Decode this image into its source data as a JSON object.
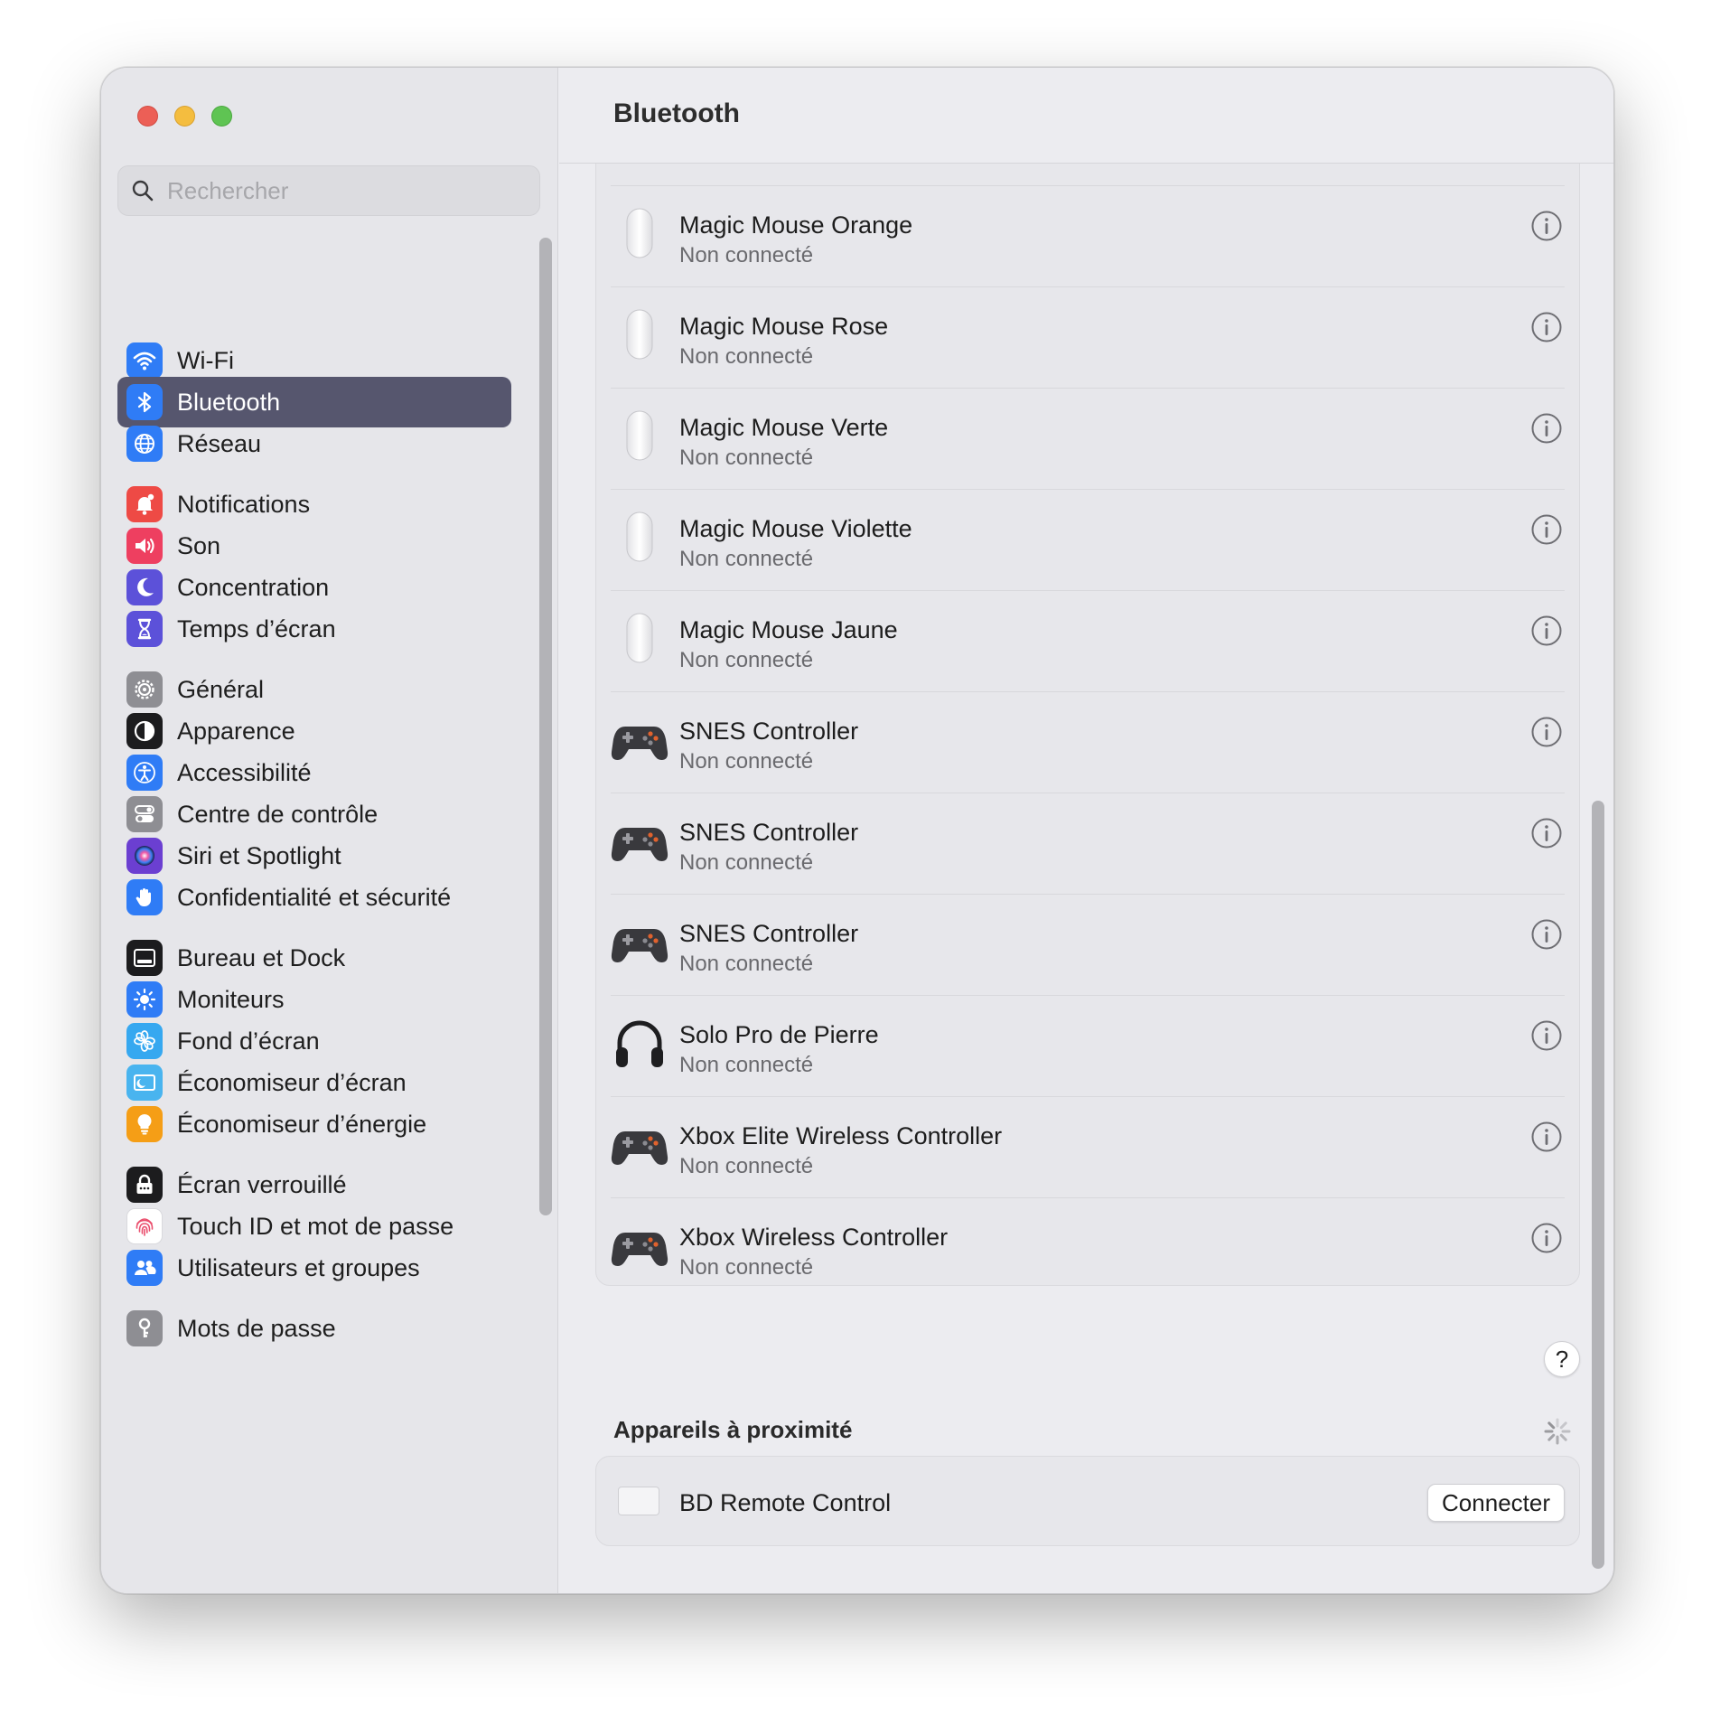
{
  "window": {
    "title": "Bluetooth"
  },
  "search": {
    "placeholder": "Rechercher"
  },
  "sidebar": {
    "items": [
      {
        "label": "Wi-Fi",
        "icon": "wifi-icon",
        "color": "#2f7cf6"
      },
      {
        "label": "Bluetooth",
        "icon": "bluetooth-icon",
        "color": "#2f7cf6",
        "active": true
      },
      {
        "label": "Réseau",
        "icon": "globe-icon",
        "color": "#2f7cf6"
      },
      {
        "label": "Notifications",
        "icon": "bell-icon",
        "color": "#ee4a45"
      },
      {
        "label": "Son",
        "icon": "speaker-icon",
        "color": "#ee3f60"
      },
      {
        "label": "Concentration",
        "icon": "moon-icon",
        "color": "#5c51d9"
      },
      {
        "label": "Temps d’écran",
        "icon": "hourglass-icon",
        "color": "#5c51d9"
      },
      {
        "label": "Général",
        "icon": "gear-icon",
        "color": "#8e8e93"
      },
      {
        "label": "Apparence",
        "icon": "appearance-icon",
        "color": "#1c1c1e"
      },
      {
        "label": "Accessibilité",
        "icon": "accessibility-icon",
        "color": "#2f7cf6"
      },
      {
        "label": "Centre de contrôle",
        "icon": "toggles-icon",
        "color": "#8e8e93"
      },
      {
        "label": "Siri et Spotlight",
        "icon": "siri-icon",
        "color": "#6b3fd1"
      },
      {
        "label": "Confidentialité et sécurité",
        "icon": "hand-icon",
        "color": "#2f7cf6"
      },
      {
        "label": "Bureau et Dock",
        "icon": "dock-icon",
        "color": "#1c1c1e"
      },
      {
        "label": "Moniteurs",
        "icon": "sun-icon",
        "color": "#2f7cf6"
      },
      {
        "label": "Fond d’écran",
        "icon": "flower-icon",
        "color": "#36a8f0"
      },
      {
        "label": "Économiseur d’écran",
        "icon": "screensaver-icon",
        "color": "#49b4ef"
      },
      {
        "label": "Économiseur d’énergie",
        "icon": "bulb-icon",
        "color": "#f59e16"
      },
      {
        "label": "Écran verrouillé",
        "icon": "lock-icon",
        "color": "#1c1c1e"
      },
      {
        "label": "Touch ID et mot de passe",
        "icon": "fingerprint-icon",
        "color": "#ffffff"
      },
      {
        "label": "Utilisateurs et groupes",
        "icon": "users-icon",
        "color": "#2f7cf6"
      },
      {
        "label": "Mots de passe",
        "icon": "key-icon",
        "color": "#8e8e93"
      }
    ]
  },
  "devices": [
    {
      "name": "",
      "status": "Non connecté",
      "icon": "mouse-icon"
    },
    {
      "name": "Magic Mouse Orange",
      "status": "Non connecté",
      "icon": "mouse-icon"
    },
    {
      "name": "Magic Mouse Rose",
      "status": "Non connecté",
      "icon": "mouse-icon"
    },
    {
      "name": "Magic Mouse Verte",
      "status": "Non connecté",
      "icon": "mouse-icon"
    },
    {
      "name": "Magic Mouse Violette",
      "status": "Non connecté",
      "icon": "mouse-icon"
    },
    {
      "name": "Magic Mouse Jaune",
      "status": "Non connecté",
      "icon": "mouse-icon"
    },
    {
      "name": "SNES Controller",
      "status": "Non connecté",
      "icon": "gamepad-icon"
    },
    {
      "name": "SNES Controller",
      "status": "Non connecté",
      "icon": "gamepad-icon"
    },
    {
      "name": "SNES Controller",
      "status": "Non connecté",
      "icon": "gamepad-icon"
    },
    {
      "name": "Solo Pro de Pierre",
      "status": "Non connecté",
      "icon": "headphones-icon"
    },
    {
      "name": "Xbox Elite Wireless Controller",
      "status": "Non connecté",
      "icon": "gamepad-icon"
    },
    {
      "name": "Xbox Wireless Controller",
      "status": "Non connecté",
      "icon": "gamepad-icon"
    }
  ],
  "help": {
    "label": "?"
  },
  "nearby": {
    "title": "Appareils à proximité",
    "devices": [
      {
        "name": "BD Remote Control",
        "action": "Connecter"
      }
    ]
  },
  "colors": {
    "sidebar_active": "#56566e",
    "accent": "#2f7cf6"
  }
}
